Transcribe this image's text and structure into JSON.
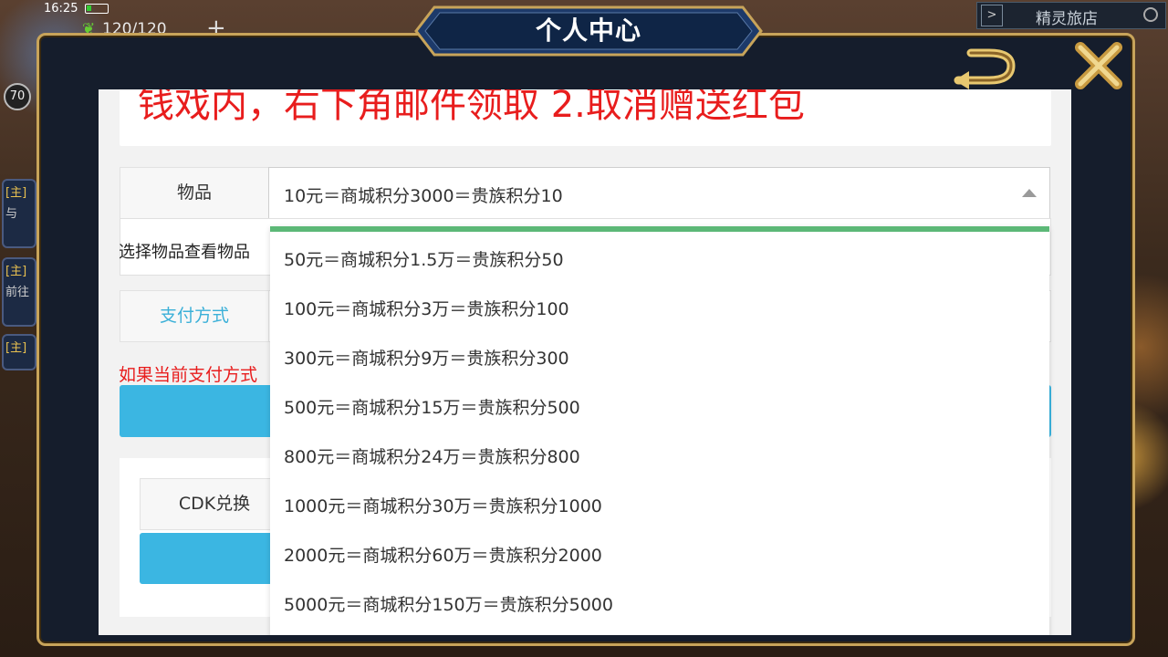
{
  "status": {
    "time": "16:25"
  },
  "hud": {
    "stamina": "120/120",
    "level": "70",
    "inn_label": "精灵旅店"
  },
  "left_quests": [
    {
      "tag": "[主]",
      "sub": "与"
    },
    {
      "tag": "[主]",
      "sub": "前往"
    },
    {
      "tag": "[主]",
      "sub": ""
    }
  ],
  "modal": {
    "title": "个人中心"
  },
  "notice": {
    "text": "钱戏内，右下角邮件领取 2.取消赠送红包"
  },
  "form": {
    "item_label": "物品",
    "item_selected": "10元＝商城积分3000＝贵族积分10",
    "item_hint": "选择物品查看物品",
    "payment_label": "支付方式",
    "payment_warning": "如果当前支付方式",
    "cdk_label": "CDK兑换"
  },
  "dropdown": {
    "options": [
      "50元＝商城积分1.5万＝贵族积分50",
      "100元＝商城积分3万＝贵族积分100",
      "300元＝商城积分9万＝贵族积分300",
      "500元＝商城积分15万＝贵族积分500",
      "800元＝商城积分24万＝贵族积分800",
      "1000元＝商城积分30万＝贵族积分1000",
      "2000元＝商城积分60万＝贵族积分2000",
      "5000元＝商城积分150万＝贵族积分5000"
    ]
  },
  "colors": {
    "accent_green": "#5cb877",
    "button_blue": "#3bb6e2",
    "warning_red": "#e81d1d",
    "gold_border": "#c8a45a"
  }
}
